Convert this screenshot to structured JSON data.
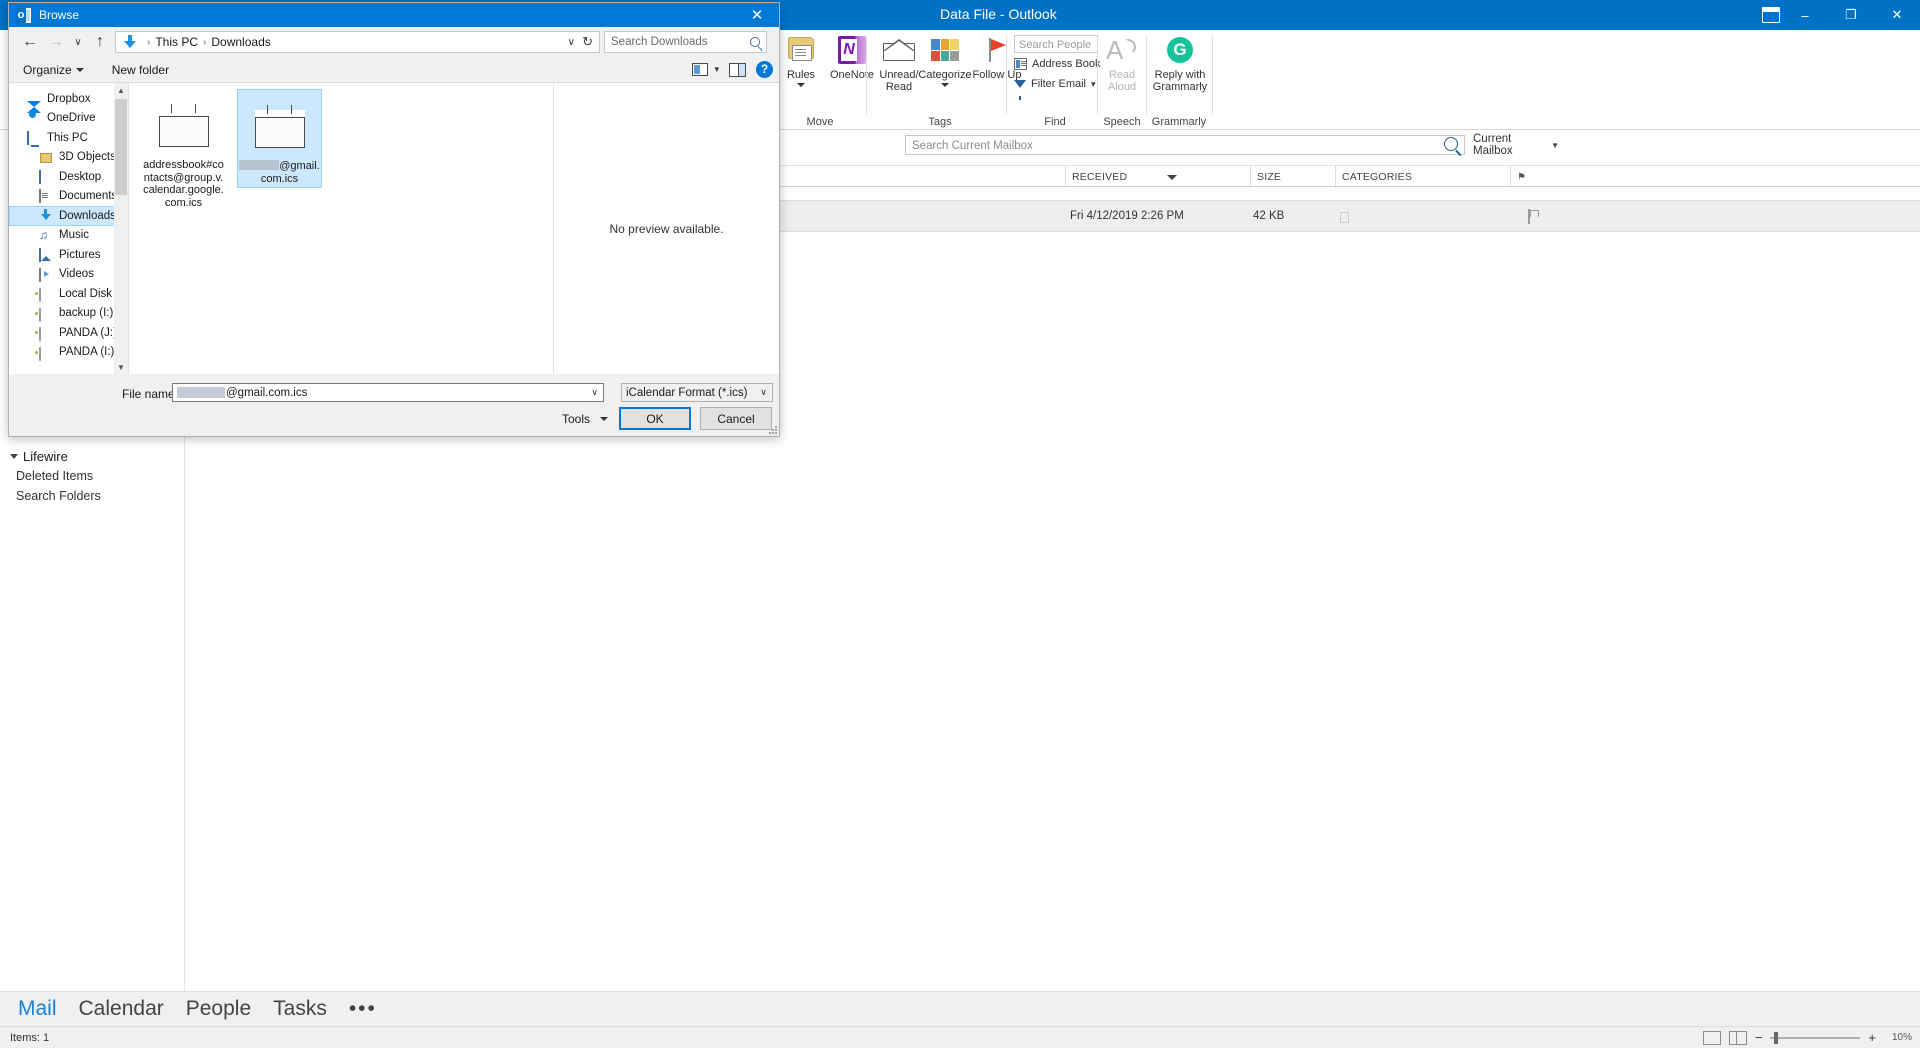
{
  "outlook": {
    "title": "Data File - Outlook",
    "window_buttons": [
      "–",
      "❐",
      "✕"
    ],
    "ribbon_toggle_icon": "ribbon-display-options-icon",
    "groups": [
      {
        "label": "Move",
        "buttons": [
          {
            "label": "Rules",
            "icon": "rules-icon",
            "has_caret": true,
            "disabled": false
          },
          {
            "label": "OneNote",
            "icon": "onenote-icon",
            "has_caret": false,
            "disabled": false
          }
        ]
      },
      {
        "label": "Tags",
        "buttons": [
          {
            "label": "Unread/ Read",
            "icon": "unread-read-envelope-icon",
            "has_caret": false,
            "disabled": false
          },
          {
            "label": "Categorize",
            "icon": "categorize-icon",
            "has_caret": true,
            "disabled": false
          },
          {
            "label": "Follow Up",
            "icon": "follow-up-flag-icon",
            "has_caret": true,
            "disabled": false
          }
        ]
      },
      {
        "label": "Find",
        "search_people_placeholder": "Search People",
        "address_book_label": "Address Book",
        "filter_email_label": "Filter Email"
      },
      {
        "label": "Speech",
        "read_aloud_label": "Read Aloud",
        "read_aloud_disabled": true
      },
      {
        "label": "Grammarly",
        "reply_label": "Reply with Grammarly"
      }
    ],
    "search": {
      "placeholder": "Search Current Mailbox",
      "scope": "Current Mailbox"
    },
    "columns": [
      {
        "label": "RECEIVED",
        "sorted": true
      },
      {
        "label": "SIZE",
        "sorted": false
      },
      {
        "label": "CATEGORIES",
        "sorted": false
      }
    ],
    "message_row": {
      "received": "Fri 4/12/2019 2:26 PM",
      "size": "42 KB",
      "category": "",
      "flag": "follow-up-flag"
    },
    "nav_pane": {
      "group_label": "Lifewire",
      "items": [
        "Deleted Items",
        "Search Folders"
      ]
    },
    "bottom_nav": {
      "items": [
        "Mail",
        "Calendar",
        "People",
        "Tasks"
      ],
      "active": "Mail",
      "overflow": "•••"
    },
    "status_bar": {
      "items_text": "Items: 1",
      "zoom": "10%",
      "zoom_out": "−",
      "zoom_in": "+"
    }
  },
  "dialog": {
    "title": "Browse",
    "title_icon": "outlook-icon",
    "close_icon": "✕",
    "nav": {
      "back_icon": "←",
      "forward_icon": "→",
      "recent_icon": "∨",
      "up_icon": "↑"
    },
    "breadcrumb": {
      "folder_icon": "downloads-arrow-icon",
      "parts": [
        "This PC",
        "Downloads"
      ],
      "separator": "›",
      "dropdown_icon": "∨",
      "refresh_icon": "↻"
    },
    "search": {
      "placeholder": "Search Downloads",
      "icon": "search-icon"
    },
    "toolbar": {
      "organize_label": "Organize",
      "new_folder_label": "New folder",
      "view_icon": "change-view-icon",
      "view_caret": "▾",
      "preview_pane_icon": "preview-pane-icon",
      "help_icon": "?"
    },
    "sidebar": {
      "items": [
        {
          "label": "Dropbox",
          "icon": "dropbox-icon",
          "indent": 0,
          "selected": false
        },
        {
          "label": "OneDrive",
          "icon": "onedrive-icon",
          "indent": 0,
          "selected": false
        },
        {
          "label": "This PC",
          "icon": "this-pc-icon",
          "indent": 0,
          "selected": false
        },
        {
          "label": "3D Objects",
          "icon": "3d-objects-icon",
          "indent": 1,
          "selected": false
        },
        {
          "label": "Desktop",
          "icon": "desktop-icon",
          "indent": 1,
          "selected": false
        },
        {
          "label": "Documents",
          "icon": "documents-icon",
          "indent": 1,
          "selected": false
        },
        {
          "label": "Downloads",
          "icon": "downloads-icon",
          "indent": 1,
          "selected": true
        },
        {
          "label": "Music",
          "icon": "music-icon",
          "indent": 1,
          "selected": false
        },
        {
          "label": "Pictures",
          "icon": "pictures-icon",
          "indent": 1,
          "selected": false
        },
        {
          "label": "Videos",
          "icon": "videos-icon",
          "indent": 1,
          "selected": false
        },
        {
          "label": "Local Disk (C:)",
          "icon": "drive-icon",
          "indent": 1,
          "selected": false
        },
        {
          "label": "backup (I:)",
          "icon": "drive-icon",
          "indent": 1,
          "selected": false
        },
        {
          "label": "PANDA (J:)",
          "icon": "drive-icon",
          "indent": 1,
          "selected": false
        },
        {
          "label": "PANDA (I:)",
          "icon": "drive-icon",
          "indent": 1,
          "selected": false
        }
      ]
    },
    "files": [
      {
        "name": "addressbook#contacts@group.v.calendar.google.com.ics",
        "icon": "ics-calendar-file-icon",
        "selected": false,
        "redacted_prefix": false
      },
      {
        "name": "@gmail.com.ics",
        "icon": "ics-calendar-file-icon",
        "selected": true,
        "redacted_prefix": true
      }
    ],
    "preview": {
      "message": "No preview available."
    },
    "footer": {
      "file_name_label": "File name:",
      "file_name_value": "@gmail.com.ics",
      "file_name_redacted_prefix": true,
      "file_name_caret": "∨",
      "format_value": "iCalendar Format (*.ics)",
      "format_caret": "∨",
      "tools_label": "Tools",
      "tools_caret": "▾",
      "ok_label": "OK",
      "cancel_label": "Cancel"
    }
  },
  "colors": {
    "accent": "#0078d7",
    "outlook_blue": "#0072c6",
    "selection": "#cce8ff",
    "selection_border": "#99d1ff",
    "grammarly_green": "#15c39a",
    "flag_red": "#e8402a"
  }
}
